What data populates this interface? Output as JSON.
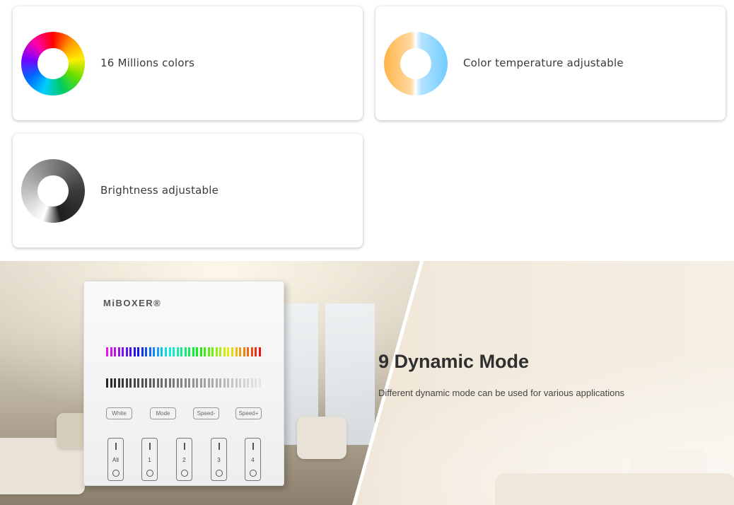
{
  "features": [
    {
      "label": "16 Millions colors",
      "icon": "rgb-color-ring-icon"
    },
    {
      "label": "Color temperature adjustable",
      "icon": "color-temperature-ring-icon"
    },
    {
      "label": "Brightness adjustable",
      "icon": "brightness-ring-icon"
    }
  ],
  "hero": {
    "title": "9 Dynamic Mode",
    "description": "Different dynamic mode can be used for various applications"
  },
  "panel": {
    "brand": "MiBOXER®",
    "buttons": [
      "White",
      "Mode",
      "Speed-",
      "Speed+"
    ],
    "zones": [
      "All",
      "1",
      "2",
      "3",
      "4"
    ]
  },
  "colors": {
    "card_shadow": "#cccccc",
    "title_text": "#2f2f2f",
    "body_text": "#3a3a3a"
  }
}
